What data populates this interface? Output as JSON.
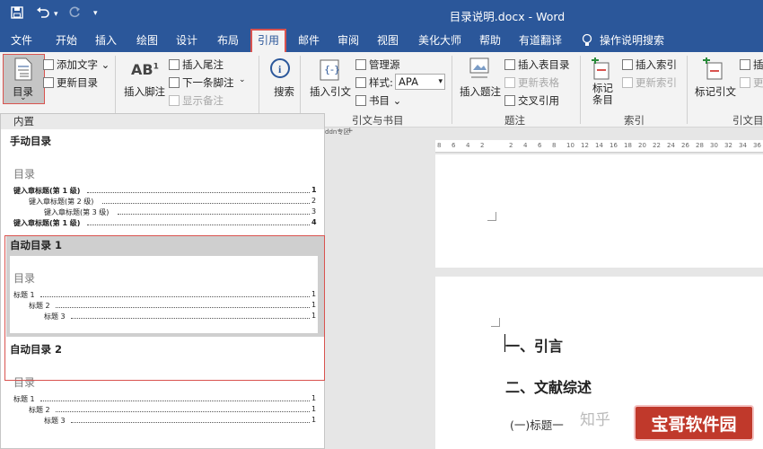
{
  "window": {
    "title": "目录说明.docx  -  Word",
    "quick_access": {
      "save_icon": "save-icon",
      "undo_icon": "undo-icon",
      "redo_icon": "redo-icon",
      "customize_icon": "customize-qat-icon"
    }
  },
  "menu": {
    "tabs": [
      "文件",
      "开始",
      "插入",
      "绘图",
      "设计",
      "布局",
      "引用",
      "邮件",
      "审阅",
      "视图",
      "美化大师",
      "帮助",
      "有道翻译"
    ],
    "active_tab": "引用",
    "tell_me": "操作说明搜索"
  },
  "ribbon": {
    "toc": {
      "label": "目录",
      "chevron": "⌄"
    },
    "toc_group": {
      "add_text": "添加文字 ⌄",
      "update_toc": "更新目录"
    },
    "footnotes": {
      "insert_footnote": "插入脚注",
      "insert_endnote": "插入尾注",
      "next_footnote": "下一条脚注",
      "next_footnote_arrow": "⌄",
      "show_notes": "显示备注"
    },
    "research": {
      "search": "搜索"
    },
    "citations": {
      "insert_citation": "插入引文",
      "manage_sources": "管理源",
      "style_label": "样式:",
      "style_value": "APA",
      "bibliography": "书目 ⌄",
      "group_label": "引文与书目"
    },
    "captions": {
      "insert_caption": "插入题注",
      "insert_table_of_figures": "插入表目录",
      "update_table": "更新表格",
      "cross_reference": "交叉引用",
      "group_label": "题注"
    },
    "index": {
      "mark_entry": "标记\n条目",
      "insert_index": "插入索引",
      "update_index": "更新索引",
      "group_label": "索引"
    },
    "toa": {
      "mark_citation": "标记引文",
      "insert_label": "插",
      "update_label": "更",
      "group_label": "引文目"
    }
  },
  "gallery": {
    "header": "内置",
    "manual": {
      "title": "手动目录",
      "heading": "目录",
      "lines": [
        {
          "text": "键入章标题(第 1 级)",
          "num": "1",
          "level": 1,
          "bold": true
        },
        {
          "text": "键入章标题(第 2 级)",
          "num": "2",
          "level": 2,
          "bold": false
        },
        {
          "text": "键入章标题(第 3 级)",
          "num": "3",
          "level": 3,
          "bold": false
        },
        {
          "text": "键入章标题(第 1 级)",
          "num": "4",
          "level": 1,
          "bold": true
        }
      ]
    },
    "auto1": {
      "title": "自动目录 1",
      "heading": "目录",
      "lines": [
        {
          "text": "标题 1",
          "num": "1",
          "level": 1
        },
        {
          "text": "标题 2",
          "num": "1",
          "level": 2
        },
        {
          "text": "标题 3",
          "num": "1",
          "level": 3
        }
      ]
    },
    "auto2": {
      "title": "自动目录 2",
      "heading": "目录",
      "lines": [
        {
          "text": "标题 1",
          "num": "1",
          "level": 1
        },
        {
          "text": "标题 2",
          "num": "1",
          "level": 2
        },
        {
          "text": "标题 3",
          "num": "1",
          "level": 3
        }
      ]
    }
  },
  "document": {
    "tab_label": "ddn专区",
    "tab_add": "+",
    "ruler_ticks": [
      "8",
      "6",
      "4",
      "2",
      "",
      "2",
      "4",
      "6",
      "8",
      "10",
      "12",
      "14",
      "16",
      "18",
      "20",
      "22",
      "24",
      "26",
      "28",
      "30",
      "32",
      "34",
      "36"
    ],
    "headings": [
      "一、引言",
      "二、文献综述"
    ],
    "subheading": "(一)标题一",
    "watermark_text": "知乎",
    "watermark_badge": "宝哥软件园"
  }
}
